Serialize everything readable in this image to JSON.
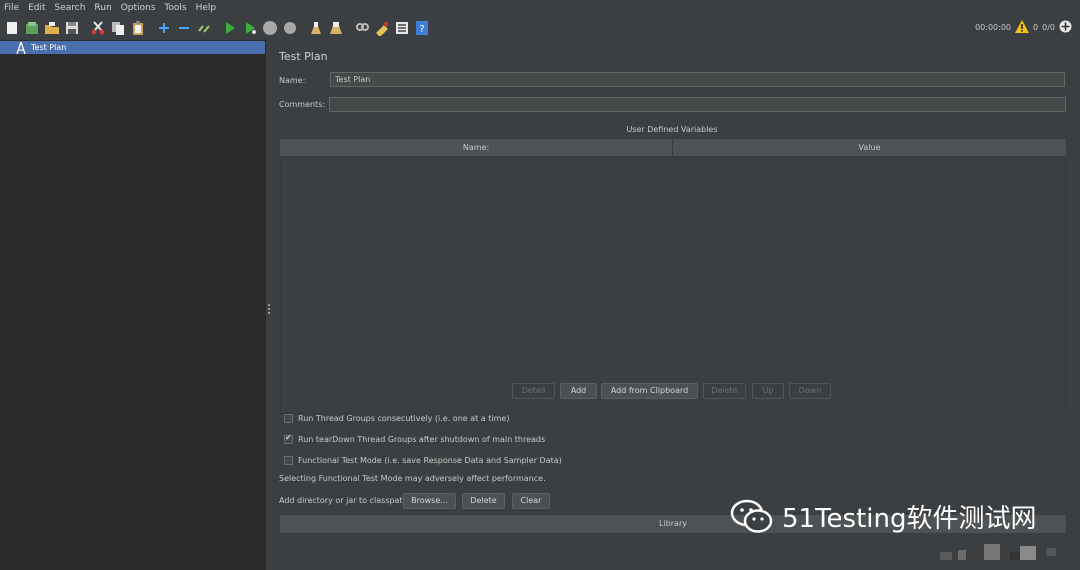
{
  "menu": [
    {
      "label": "File"
    },
    {
      "label": "Edit"
    },
    {
      "label": "Search"
    },
    {
      "label": "Run"
    },
    {
      "label": "Options"
    },
    {
      "label": "Tools"
    },
    {
      "label": "Help"
    }
  ],
  "toolbar": {
    "icons": [
      "new-icon",
      "templates-icon",
      "open-icon",
      "save-icon",
      "cut-icon",
      "copy-icon",
      "paste-icon",
      "expand-icon",
      "collapse-icon",
      "toggle-icon",
      "start-icon",
      "start-no-pauses-icon",
      "stop-icon",
      "shutdown-icon",
      "clear-icon",
      "clear-all-icon",
      "search-icon",
      "reset-search-icon",
      "function-helper-icon",
      "help-icon"
    ],
    "timer": "00:00:00",
    "warning_count": "0",
    "threads": "0/0"
  },
  "tree": {
    "items": [
      {
        "label": "Test Plan"
      }
    ]
  },
  "main": {
    "title": "Test Plan",
    "name_label": "Name:",
    "name_value": "Test Plan",
    "comments_label": "Comments:",
    "comments_value": "",
    "udv_title": "User Defined Variables",
    "columns": [
      "Name:",
      "Value"
    ],
    "buttons": {
      "detail": "Detail",
      "add": "Add",
      "add_clipboard": "Add from Clipboard",
      "delete": "Delete",
      "up": "Up",
      "down": "Down"
    },
    "options": [
      {
        "label": "Run Thread Groups consecutively (i.e. one at a time)",
        "checked": false
      },
      {
        "label": "Run tearDown Thread Groups after shutdown of main threads",
        "checked": true
      },
      {
        "label": "Functional Test Mode (i.e. save Response Data and Sampler Data)",
        "checked": false
      }
    ],
    "functional_note": "Selecting Functional Test Mode may adversely affect performance.",
    "classpath_label": "Add directory or jar to classpath",
    "classpath_buttons": {
      "browse": "Browse...",
      "delete": "Delete",
      "clear": "Clear"
    },
    "library_header": "Library"
  },
  "watermark": "51Testing软件测试网"
}
